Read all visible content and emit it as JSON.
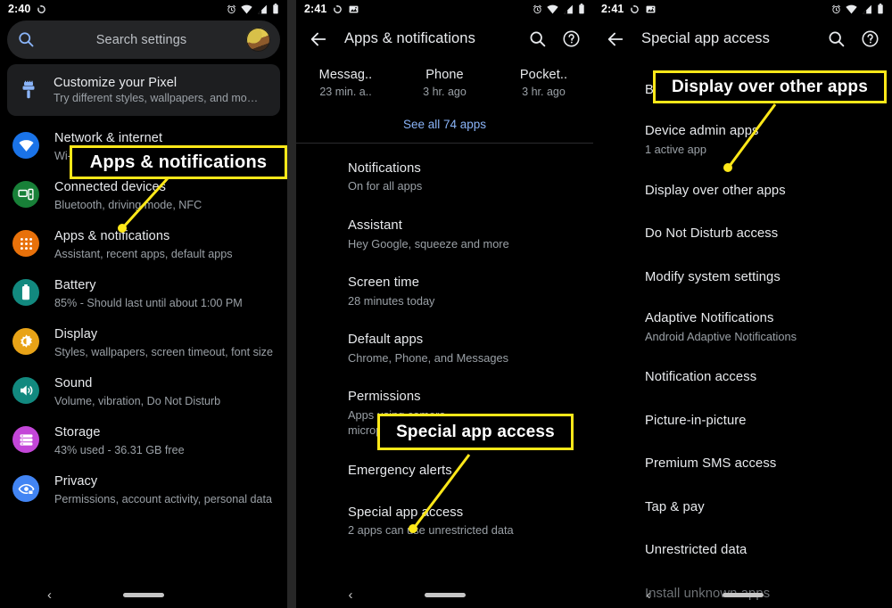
{
  "panels": [
    {
      "id": "settings-home",
      "statusbar": {
        "time": "2:40",
        "left_icons": [
          "sync-icon"
        ],
        "right_icons": [
          "alarm-icon",
          "wifi-icon",
          "signal-icon",
          "battery-icon"
        ]
      },
      "search": {
        "placeholder": "Search settings",
        "icon": "search-icon",
        "avatar": "account-avatar"
      },
      "customize_card": {
        "title": "Customize your Pixel",
        "subtitle": "Try different styles, wallpapers, and mo…",
        "icon": "brush-icon"
      },
      "items": [
        {
          "title": "Network & internet",
          "subtitle": "Wi-Fi, mobile, data usage, and hotspot",
          "icon": "wifi-icon",
          "color": "#1a73e8"
        },
        {
          "title": "Connected devices",
          "subtitle": "Bluetooth, driving mode, NFC",
          "icon": "devices-icon",
          "color": "#188038"
        },
        {
          "title": "Apps & notifications",
          "subtitle": "Assistant, recent apps, default apps",
          "icon": "apps-grid-icon",
          "color": "#e8710a"
        },
        {
          "title": "Battery",
          "subtitle": "85% - Should last until about 1:00 PM",
          "icon": "battery-icon",
          "color": "#12897f"
        },
        {
          "title": "Display",
          "subtitle": "Styles, wallpapers, screen timeout, font size",
          "icon": "brightness-icon",
          "color": "#e8a317"
        },
        {
          "title": "Sound",
          "subtitle": "Volume, vibration, Do Not Disturb",
          "icon": "volume-icon",
          "color": "#12897f"
        },
        {
          "title": "Storage",
          "subtitle": "43% used - 36.31 GB free",
          "icon": "storage-icon",
          "color": "#c346d8"
        },
        {
          "title": "Privacy",
          "subtitle": "Permissions, account activity, personal data",
          "icon": "privacy-eye-icon",
          "color": "#4285f4"
        }
      ],
      "navbar": {
        "pill": "home-pill",
        "back": "‹"
      }
    },
    {
      "id": "apps-and-notifications",
      "statusbar": {
        "time": "2:41",
        "left_icons": [
          "sync-icon",
          "screenshot-icon"
        ],
        "right_icons": [
          "alarm-icon",
          "wifi-icon",
          "signal-icon",
          "battery-icon"
        ]
      },
      "appbar": {
        "back": "back-arrow-icon",
        "title": "Apps & notifications",
        "actions": [
          "search-icon",
          "help-icon"
        ]
      },
      "recents": [
        {
          "name": "Messag..",
          "time": "23 min. a.."
        },
        {
          "name": "Phone",
          "time": "3 hr. ago"
        },
        {
          "name": "Pocket..",
          "time": "3 hr. ago"
        }
      ],
      "see_all": "See all 74 apps",
      "items": [
        {
          "title": "Notifications",
          "subtitle": "On for all apps"
        },
        {
          "title": "Assistant",
          "subtitle": "Hey Google, squeeze and more"
        },
        {
          "title": "Screen time",
          "subtitle": "28 minutes today"
        },
        {
          "title": "Default apps",
          "subtitle": "Chrome, Phone, and Messages"
        },
        {
          "title": "Permissions",
          "subtitle": "Apps using camera, microphone, and location"
        },
        {
          "title": "Emergency alerts",
          "subtitle": ""
        },
        {
          "title": "Special app access",
          "subtitle": "2 apps can use unrestricted data"
        }
      ],
      "navbar": {
        "pill": "home-pill",
        "back": "‹"
      }
    },
    {
      "id": "special-app-access",
      "statusbar": {
        "time": "2:41",
        "left_icons": [
          "sync-icon",
          "screenshot-icon"
        ],
        "right_icons": [
          "alarm-icon",
          "wifi-icon",
          "signal-icon",
          "battery-icon"
        ]
      },
      "appbar": {
        "back": "back-arrow-icon",
        "title": "Special app access",
        "actions": [
          "search-icon",
          "help-icon"
        ]
      },
      "items": [
        {
          "title": "Battery optimization",
          "subtitle": ""
        },
        {
          "title": "Device admin apps",
          "subtitle": "1 active app"
        },
        {
          "title": "Display over other apps",
          "subtitle": ""
        },
        {
          "title": "Do Not Disturb access",
          "subtitle": ""
        },
        {
          "title": "Modify system settings",
          "subtitle": ""
        },
        {
          "title": "Adaptive Notifications",
          "subtitle": "Android Adaptive Notifications"
        },
        {
          "title": "Notification access",
          "subtitle": ""
        },
        {
          "title": "Picture-in-picture",
          "subtitle": ""
        },
        {
          "title": "Premium SMS access",
          "subtitle": ""
        },
        {
          "title": "Tap & pay",
          "subtitle": ""
        },
        {
          "title": "Unrestricted data",
          "subtitle": ""
        },
        {
          "title": "Install unknown apps",
          "subtitle": ""
        }
      ],
      "navbar": {
        "pill": "home-pill",
        "back": "‹"
      }
    }
  ],
  "annotations": [
    {
      "id": "anno-apps-notifications",
      "label": "Apps & notifications"
    },
    {
      "id": "anno-special-app-access",
      "label": "Special app access"
    },
    {
      "id": "anno-display-over-other-apps",
      "label": "Display over other apps"
    }
  ],
  "colors": {
    "annotation": "#ffe819",
    "link": "#8ab4f8",
    "title": "#e8eaed",
    "subtitle": "#9aa0a6"
  }
}
